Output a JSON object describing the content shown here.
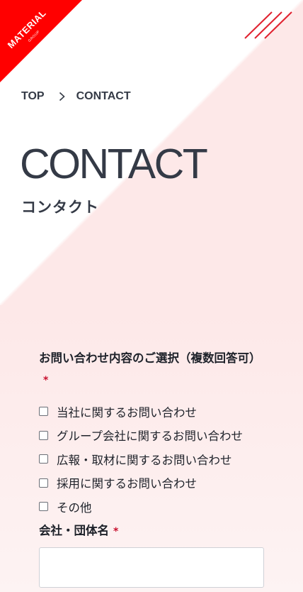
{
  "logo": {
    "text": "MATERIAL",
    "subtext": "GROUP",
    "color": "#ff0000"
  },
  "breadcrumb": {
    "items": [
      "TOP",
      "CONTACT"
    ],
    "separator_icon": "chevron-right-icon"
  },
  "page": {
    "title": "CONTACT",
    "subtitle": "コンタクト"
  },
  "form": {
    "inquiry_label": "お問い合わせ内容のご選択（複数回答可）",
    "required_mark": "*",
    "options": [
      "当社に関するお問い合わせ",
      "グループ会社に関するお問い合わせ",
      "広報・取材に関するお問い合わせ",
      "採用に関するお問い合わせ",
      "その他"
    ],
    "company_label": "会社・団体名",
    "company_value": ""
  },
  "colors": {
    "accent": "#e0202e",
    "text": "#343a46",
    "required": "#c8102e",
    "background_pink": "#fde8e8"
  }
}
